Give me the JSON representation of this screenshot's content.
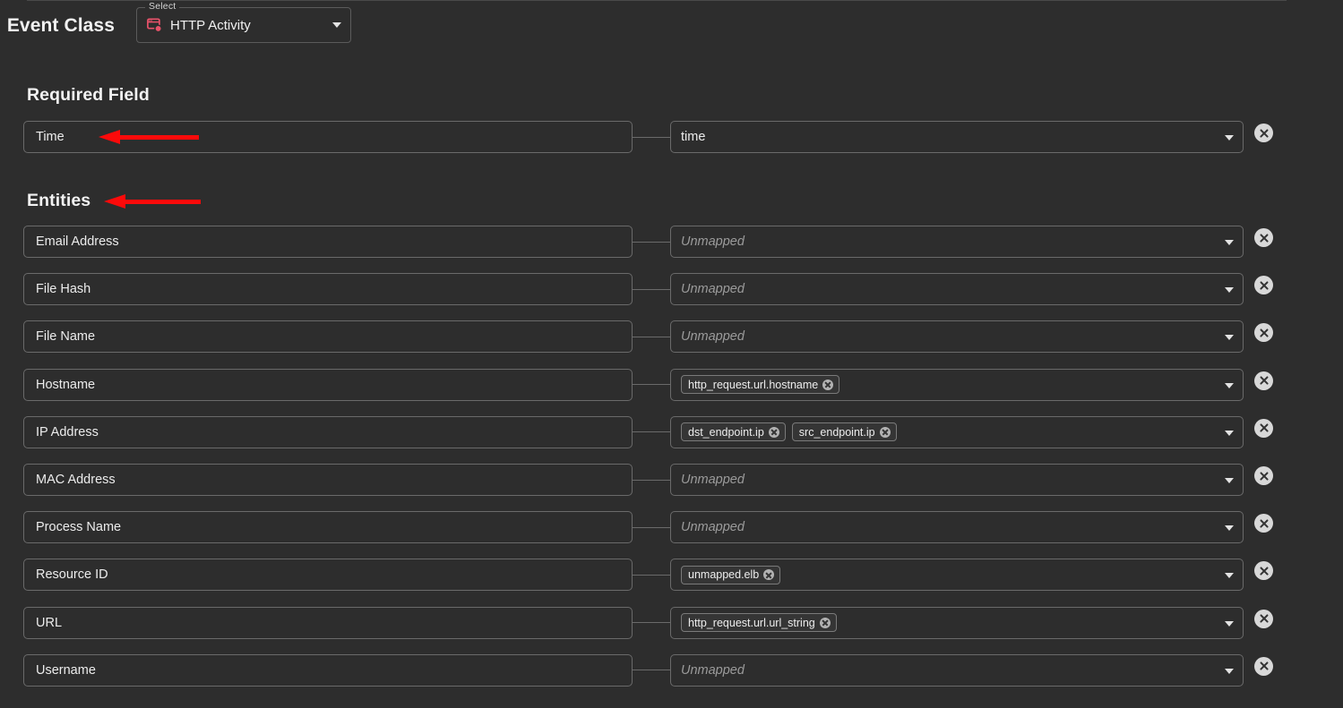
{
  "header": {
    "event_class_label": "Event Class",
    "select_legend": "Select",
    "select_value": "HTTP Activity",
    "select_icon": "browser-window-icon"
  },
  "sections": {
    "required_field": "Required Field",
    "entities": "Entities"
  },
  "annotations": {
    "accent_color": "#fb0a0a",
    "arrows": [
      {
        "name": "arrow-to-time-row",
        "points_to": "Time"
      },
      {
        "name": "arrow-to-entities-heading",
        "points_to": "Entities"
      }
    ]
  },
  "colors": {
    "background": "#2d2d2d",
    "border": "#6a6a6a",
    "text": "#ececec",
    "placeholder": "#9b9b9b",
    "chip_background": "#353535",
    "delete_button": "#d8d8d8",
    "icon_accent": "#e8526a"
  },
  "placeholder_text": "Unmapped",
  "required_rows": [
    {
      "label": "Time",
      "value": "time",
      "chips": [],
      "remove_label": "remove"
    }
  ],
  "entity_rows": [
    {
      "label": "Email Address",
      "value": "",
      "chips": []
    },
    {
      "label": "File Hash",
      "value": "",
      "chips": []
    },
    {
      "label": "File Name",
      "value": "",
      "chips": []
    },
    {
      "label": "Hostname",
      "value": "",
      "chips": [
        "http_request.url.hostname"
      ]
    },
    {
      "label": "IP Address",
      "value": "",
      "chips": [
        "dst_endpoint.ip",
        "src_endpoint.ip"
      ]
    },
    {
      "label": "MAC Address",
      "value": "",
      "chips": []
    },
    {
      "label": "Process Name",
      "value": "",
      "chips": []
    },
    {
      "label": "Resource ID",
      "value": "",
      "chips": [
        "unmapped.elb"
      ]
    },
    {
      "label": "URL",
      "value": "",
      "chips": [
        "http_request.url.url_string"
      ]
    },
    {
      "label": "Username",
      "value": "",
      "chips": []
    }
  ]
}
